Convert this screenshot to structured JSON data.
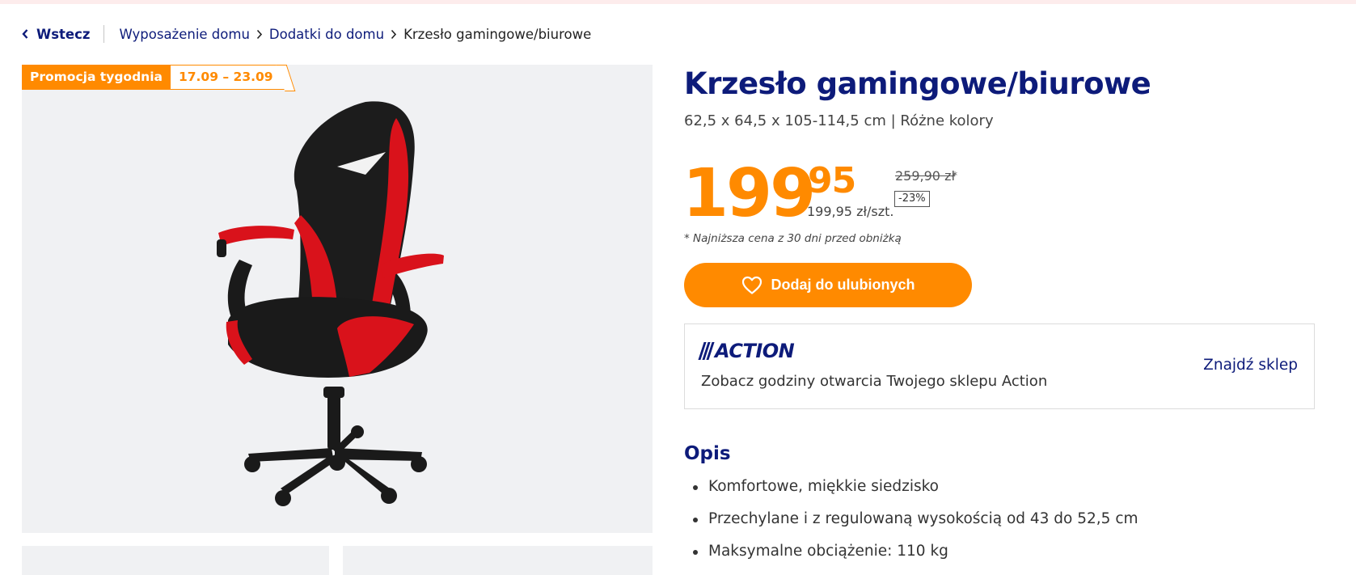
{
  "breadcrumb": {
    "back_label": "Wstecz",
    "items": [
      "Wyposażenie domu",
      "Dodatki do domu"
    ],
    "current": "Krzesło gamingowe/biurowe"
  },
  "promo": {
    "label": "Promocja tygodnia",
    "dates": "17.09 – 23.09"
  },
  "product": {
    "title": "Krzesło gamingowe/biurowe",
    "subtitle": "62,5 x 64,5 x 105-114,5 cm | Różne kolory",
    "image_icon": "office-chair"
  },
  "price": {
    "integer": "199",
    "decimal": "95",
    "unit": "199,95 zł/szt.",
    "old": "259,90 zł",
    "old_mark": "*",
    "discount": "-23%",
    "lowest_note": "* Najniższa cena z 30 dni przed obniżką"
  },
  "favorite_button": {
    "label": "Dodaj do ulubionych",
    "icon": "heart-outline-icon"
  },
  "store": {
    "logo": "ACTION",
    "text": "Zobacz godziny otwarcia Twojego sklepu Action",
    "link": "Znajdź sklep"
  },
  "description": {
    "heading": "Opis",
    "features": [
      "Komfortowe, miękkie siedzisko",
      "Przechylane i z regulowaną wysokością od 43 do 52,5 cm",
      "Maksymalne obciążenie: 110 kg"
    ]
  },
  "colors": {
    "brand_blue": "#0d1b7a",
    "accent_orange": "#ff8a00",
    "chair_red": "#d9121b"
  }
}
